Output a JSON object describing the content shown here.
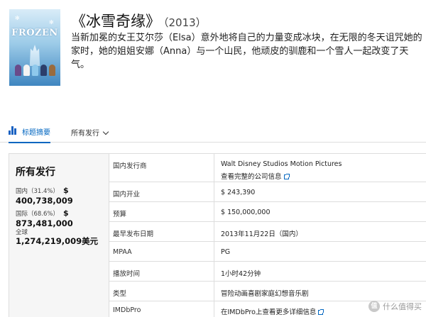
{
  "movie": {
    "poster_logo": "FROZEN",
    "title": "《冰雪奇缘》",
    "year": "（2013）",
    "synopsis": "当新加冕的女王艾尔莎（Elsa）意外地将自己的力量变成冰块，在无限的冬天诅咒她的家时，她的姐姐安娜（Anna）与一个山民，他顽皮的驯鹿和一个雪人一起改变了天气。"
  },
  "tabs": {
    "summary_label": "标题摘要",
    "releases_label": "所有发行"
  },
  "summary": {
    "heading": "所有发行",
    "domestic_label": "国内（31.4%）",
    "domestic_amount": "400,738,009",
    "international_label": "国际（68.6%）",
    "international_amount": "873,481,000",
    "worldwide_label": "全球",
    "worldwide_amount": "1,274,219,009美元",
    "dollar_sign": "$"
  },
  "details": {
    "distributor_key": "国内发行商",
    "distributor_value": "Walt Disney Studios Motion Pictures",
    "distributor_link": "查看完整的公司信息",
    "opening_key": "国内开业",
    "opening_value": "$ 243,390",
    "budget_key": "预算",
    "budget_value": "$ 150,000,000",
    "release_key": "最早发布日期",
    "release_value": "2013年11月22日（国内）",
    "mpaa_key": "MPAA",
    "mpaa_value": "PG",
    "runtime_key": "播放时间",
    "runtime_value": "1小时42分钟",
    "genre_key": "类型",
    "genre_value": "冒险动画喜剧家庭幻想音乐剧",
    "imdbpro_key": "IMDbPro",
    "imdbpro_link": "在IMDbPro上查看更多详细信息"
  },
  "watermark": {
    "badge": "值",
    "text": "什么值得买"
  },
  "colors": {
    "link": "#0066c0",
    "summary_bg": "#f6f6f6"
  }
}
